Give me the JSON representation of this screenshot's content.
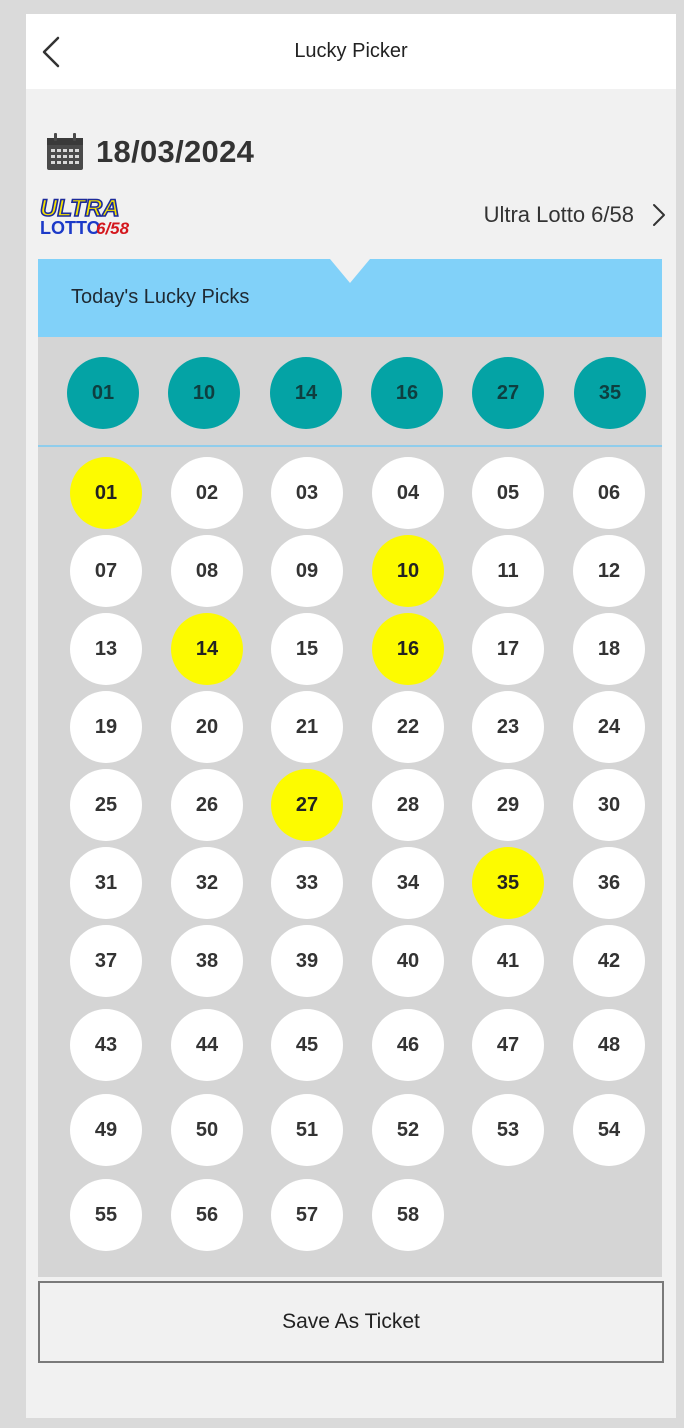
{
  "header": {
    "title": "Lucky Picker"
  },
  "date": "18/03/2024",
  "game": {
    "name": "Ultra Lotto 6/58",
    "logo_top": "ULTRA",
    "logo_bottom": "LOTTO",
    "logo_suffix": "6/58"
  },
  "lucky": {
    "title": "Today's Lucky Picks",
    "picks": [
      "01",
      "10",
      "14",
      "16",
      "27",
      "35"
    ]
  },
  "numbers": [
    "01",
    "02",
    "03",
    "04",
    "05",
    "06",
    "07",
    "08",
    "09",
    "10",
    "11",
    "12",
    "13",
    "14",
    "15",
    "16",
    "17",
    "18",
    "19",
    "20",
    "21",
    "22",
    "23",
    "24",
    "25",
    "26",
    "27",
    "28",
    "29",
    "30",
    "31",
    "32",
    "33",
    "34",
    "35",
    "36",
    "37",
    "38",
    "39",
    "40",
    "41",
    "42",
    "43",
    "44",
    "45",
    "46",
    "47",
    "48",
    "49",
    "50",
    "51",
    "52",
    "53",
    "54",
    "55",
    "56",
    "57",
    "58"
  ],
  "save_label": "Save As Ticket",
  "colors": {
    "accent": "#81d1f9",
    "pick_ball": "#04a3a5",
    "selected_ball": "#fdfb00",
    "ball": "#ffffff"
  }
}
